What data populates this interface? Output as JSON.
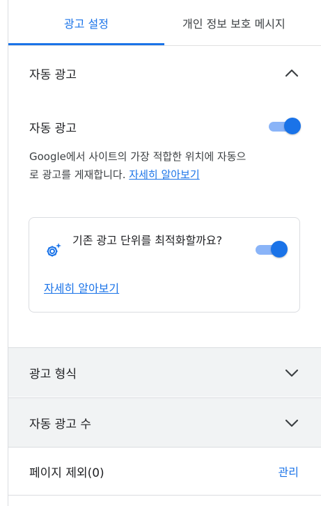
{
  "tabs": [
    {
      "label": "광고 설정",
      "selected": true
    },
    {
      "label": "개인 정보 보호 메시지",
      "selected": false
    }
  ],
  "auto_ads_section": {
    "title": "자동 광고",
    "expanded": true,
    "toggle_label": "자동 광고",
    "toggle_on": true,
    "description": "Google에서 사이트의 가장 적합한 위치에 자동으로 광고를 게재합니다. ",
    "learn_more": "자세히 알아보기",
    "optimize_card": {
      "icon": "gear-sparkle-icon",
      "text": "기존 광고 단위를 최적화할까요?",
      "toggle_on": true,
      "learn_more": "자세히 알아보기"
    }
  },
  "ad_formats_section": {
    "title": "광고 형식",
    "expanded": false
  },
  "ad_load_section": {
    "title": "자동 광고 수",
    "expanded": false
  },
  "page_exclusions": {
    "label": "페이지 제외(0)",
    "action": "관리"
  },
  "colors": {
    "accent": "#1a73e8",
    "toggle_track": "#8ab4f8",
    "collapsed_bg": "#f1f3f4"
  }
}
